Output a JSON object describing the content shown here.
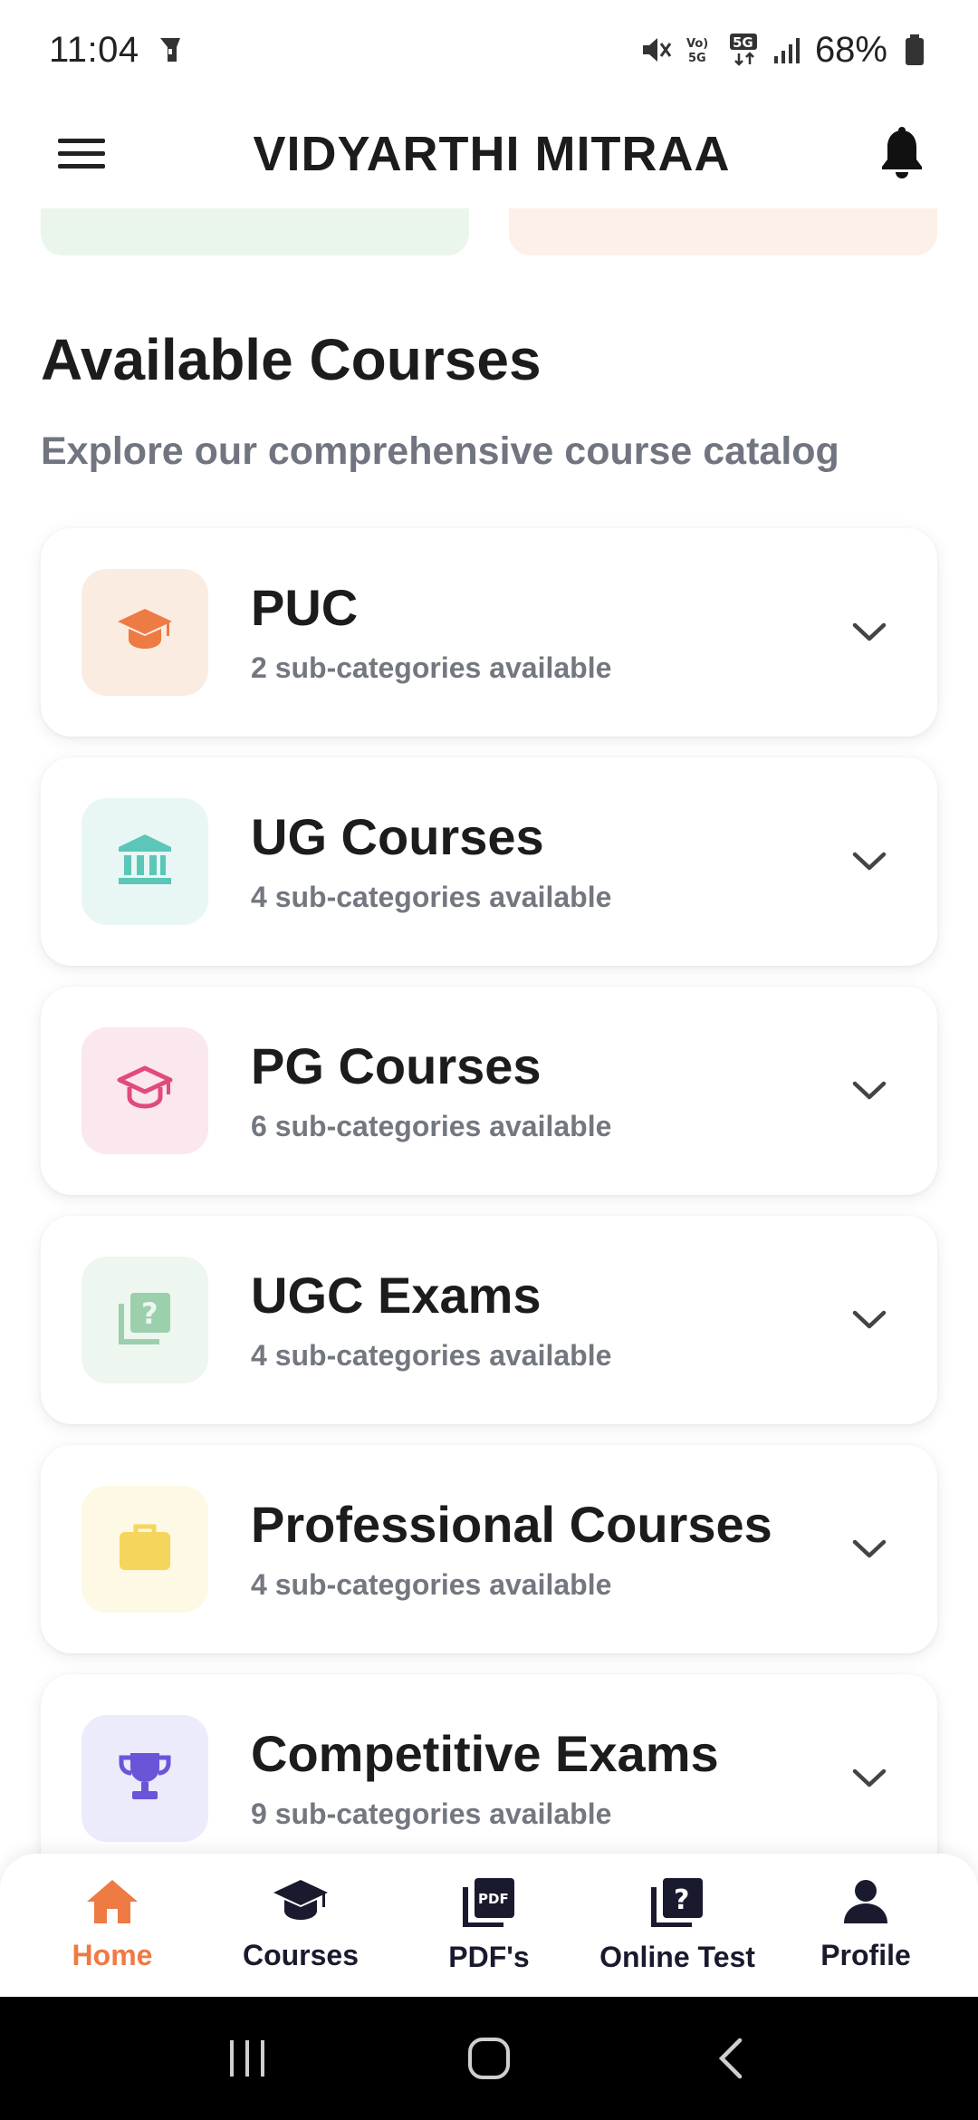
{
  "status_bar": {
    "time": "11:04",
    "battery": "68%"
  },
  "app_bar": {
    "title": "VIDYARTHI MITRAA"
  },
  "section": {
    "title": "Available Courses",
    "subtitle": "Explore our comprehensive course catalog"
  },
  "courses": [
    {
      "title": "PUC",
      "subtitle": "2 sub-categories available",
      "icon": "graduation-cap-icon",
      "bg": "#fbece2",
      "color": "#ee7a44"
    },
    {
      "title": "UG Courses",
      "subtitle": "4 sub-categories available",
      "icon": "institution-icon",
      "bg": "#e8f7f5",
      "color": "#5cc6b8"
    },
    {
      "title": "PG Courses",
      "subtitle": "6 sub-categories available",
      "icon": "graduation-cap-outline-icon",
      "bg": "#fbe7ee",
      "color": "#e04b7a"
    },
    {
      "title": "UGC Exams",
      "subtitle": "4 sub-categories available",
      "icon": "quiz-icon",
      "bg": "#eef6f0",
      "color": "#9ccfab"
    },
    {
      "title": "Professional Courses",
      "subtitle": "4 sub-categories available",
      "icon": "briefcase-icon",
      "bg": "#fdf9e4",
      "color": "#f6d55c"
    },
    {
      "title": "Competitive Exams",
      "subtitle": "9 sub-categories available",
      "icon": "trophy-icon",
      "bg": "#ecebfb",
      "color": "#6a55d8"
    }
  ],
  "bottom_nav": [
    {
      "label": "Home",
      "icon": "home-icon",
      "active": true
    },
    {
      "label": "Courses",
      "icon": "graduation-cap-icon",
      "active": false
    },
    {
      "label": "PDF's",
      "icon": "pdf-icon",
      "active": false
    },
    {
      "label": "Online Test",
      "icon": "quiz-icon",
      "active": false
    },
    {
      "label": "Profile",
      "icon": "person-icon",
      "active": false
    }
  ],
  "colors": {
    "accent": "#ee7a44",
    "nav_dark": "#1a1a2e"
  }
}
